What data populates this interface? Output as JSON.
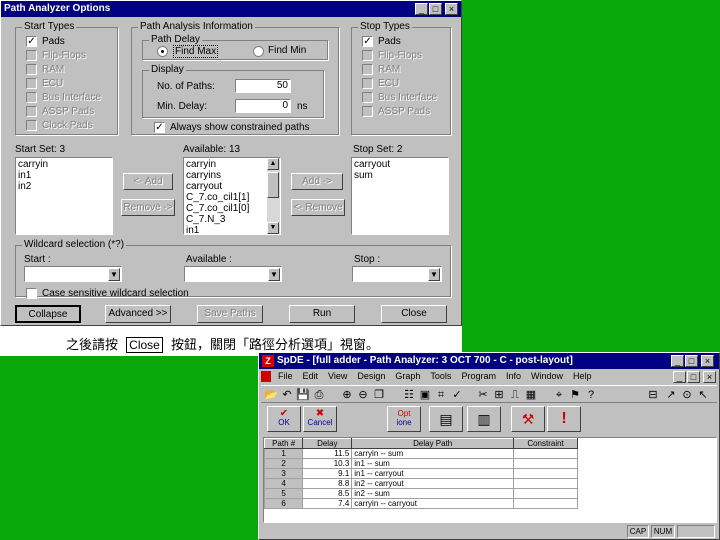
{
  "dialog": {
    "title": "Path Analyzer Options",
    "start_types": {
      "label": "Start Types",
      "items": [
        {
          "label": "Pads",
          "checked": true,
          "enabled": true
        },
        {
          "label": "Flip-Flops",
          "checked": false,
          "enabled": false
        },
        {
          "label": "RAM",
          "checked": false,
          "enabled": false
        },
        {
          "label": "ECU",
          "checked": false,
          "enabled": false
        },
        {
          "label": "Bus Interface",
          "checked": false,
          "enabled": false
        },
        {
          "label": "ASSP Pads",
          "checked": false,
          "enabled": false
        },
        {
          "label": "Clock Pads",
          "checked": false,
          "enabled": false
        }
      ]
    },
    "path_analysis": {
      "label": "Path Analysis Information",
      "path_delay_label": "Path Delay",
      "find_max": "Find Max",
      "find_min": "Find Min",
      "display_label": "Display",
      "num_paths_label": "No. of Paths:",
      "num_paths_value": "50",
      "min_delay_label": "Min. Delay:",
      "min_delay_value": "0",
      "min_delay_unit": "ns",
      "always_show": "Always show constrained paths"
    },
    "stop_types": {
      "label": "Stop Types",
      "items": [
        {
          "label": "Pads",
          "checked": true,
          "enabled": true
        },
        {
          "label": "Flip-Flops",
          "checked": false,
          "enabled": false
        },
        {
          "label": "RAM",
          "checked": false,
          "enabled": false
        },
        {
          "label": "ECU",
          "checked": false,
          "enabled": false
        },
        {
          "label": "Bus Interface",
          "checked": false,
          "enabled": false
        },
        {
          "label": "ASSP Pads",
          "checked": false,
          "enabled": false
        }
      ]
    },
    "start_set": {
      "label": "Start Set: 3",
      "items": [
        "carryin",
        "in1",
        "in2"
      ]
    },
    "available": {
      "label": "Available: 13",
      "items": [
        "carryin",
        "carryins",
        "carryout",
        "C_7.co_cil1[1]",
        "C_7.co_cil1[0]",
        "C_7.N_3",
        "in1"
      ]
    },
    "stop_set": {
      "label": "Stop Set: 2",
      "items": [
        "carryout",
        "sum"
      ]
    },
    "add_left": "<- Add",
    "remove_left": "Remove ->",
    "add_right": "Add ->",
    "remove_right": "<- Remove",
    "wildcard": {
      "label": "Wildcard selection (*?)",
      "start_label": "Start :",
      "available_label": "Available :",
      "stop_label": "Stop :",
      "case_sensitive": "Case sensitive wildcard selection"
    },
    "buttons": {
      "collapse": "Collapse",
      "advanced": "Advanced >>",
      "save_paths": "Save Paths",
      "run": "Run",
      "close": "Close"
    }
  },
  "caption": {
    "before": "之後請按",
    "boxed": "Close",
    "after": "按鈕，關閉「路徑分析選項」視窗。"
  },
  "app": {
    "title": "SpDE - [full adder - Path Analyzer: 3 OCT 700 - C - post-layout]",
    "menu": [
      "File",
      "Edit",
      "View",
      "Design",
      "Graph",
      "Tools",
      "Program",
      "Info",
      "Window",
      "Help"
    ],
    "ok_label": "OK",
    "cancel_label": "Cancel",
    "opt_label1": "Opt",
    "opt_label2": "ione",
    "columns": [
      "Path #",
      "Delay",
      "Delay Path",
      "Constraint"
    ],
    "rows": [
      {
        "path": "1",
        "delay": "11.5",
        "dpath": "carryin -- sum"
      },
      {
        "path": "2",
        "delay": "10.3",
        "dpath": "in1 -- sum"
      },
      {
        "path": "3",
        "delay": "9.1",
        "dpath": "in1 -- carryout"
      },
      {
        "path": "4",
        "delay": "8.8",
        "dpath": "in2 -- carryout"
      },
      {
        "path": "5",
        "delay": "8.5",
        "dpath": "in2 -- sum"
      },
      {
        "path": "6",
        "delay": "7.4",
        "dpath": "carryin -- carryout"
      }
    ],
    "status": [
      "CAP",
      "NUM"
    ]
  }
}
